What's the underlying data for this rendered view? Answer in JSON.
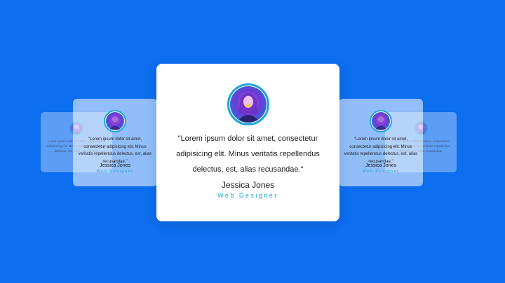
{
  "colors": {
    "background": "#0d6ef0",
    "card": "#ffffff",
    "accent": "#1ba7d6",
    "text": "#1e1e1e"
  },
  "testimonials": [
    {
      "position": "far-left",
      "quote": "Lorem ipsum dolor sit amet, consectetur adipisicing elit. Minus veritatis repellendus delectus, est, alias recusandae.",
      "avatar_icon": "person-photo-icon"
    },
    {
      "position": "near-left",
      "quote": "\"Lorem ipsum dolor sit amet, consectetur adipisicing elit. Minus veritatis repellendus delectus, est, alias recusandae.\"",
      "name": "Jessica Jones",
      "role": "Web Designer",
      "avatar_icon": "person-photo-icon"
    },
    {
      "position": "center",
      "quote": "\"Lorem ipsum dolor sit amet, consectetur adipisicing elit. Minus veritatis repellendus delectus, est, alias recusandae.\"",
      "name": "Jessica Jones",
      "role": "Web Designer",
      "avatar_icon": "person-photo-icon"
    },
    {
      "position": "near-right",
      "quote": "\"Lorem ipsum dolor sit amet, consectetur adipisicing elit. Minus veritatis repellendus delectus, est, alias recusandae.\"",
      "name": "Jessica Jones",
      "role": "Web Designer",
      "avatar_icon": "person-photo-icon"
    },
    {
      "position": "far-right",
      "quote": "Lorem ipsum dolor sit amet, consectetur adipisicing elit. Minus veritatis repellendus delectus, est, alias recusandae.",
      "avatar_icon": "person-photo-icon"
    }
  ]
}
